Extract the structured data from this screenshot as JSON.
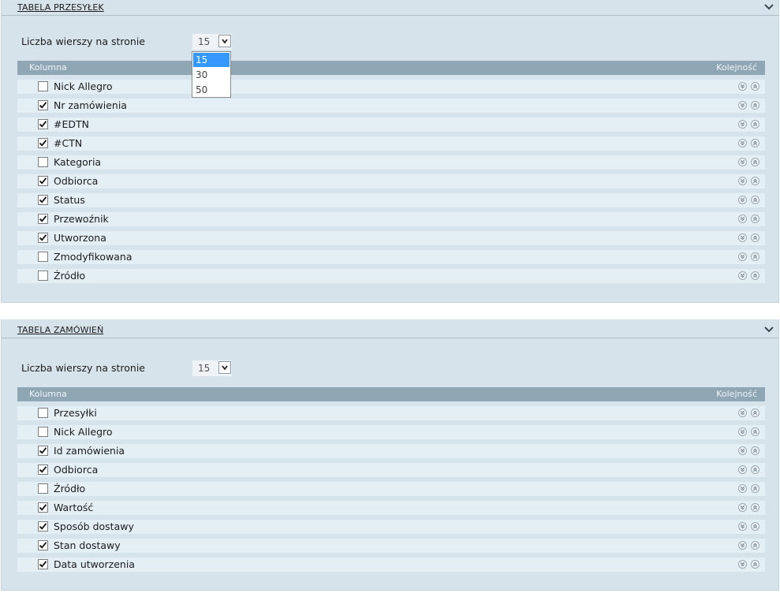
{
  "panels": [
    {
      "title": "TABELA PRZESYŁEK",
      "rows_label": "Liczba wierszy na stronie",
      "rows_per_page": "15",
      "header": {
        "column": "Kolumna",
        "order": "Kolejność"
      },
      "rows": [
        {
          "label": "Nick Allegro",
          "checked": false
        },
        {
          "label": "Nr zamówienia",
          "checked": true
        },
        {
          "label": "#EDTN",
          "checked": true
        },
        {
          "label": "#CTN",
          "checked": true
        },
        {
          "label": "Kategoria",
          "checked": false
        },
        {
          "label": "Odbiorca",
          "checked": true
        },
        {
          "label": "Status",
          "checked": true
        },
        {
          "label": "Przewoźnik",
          "checked": true
        },
        {
          "label": "Utworzona",
          "checked": true
        },
        {
          "label": "Zmodyfikowana",
          "checked": false
        },
        {
          "label": "Źródło",
          "checked": false
        }
      ]
    },
    {
      "title": "TABELA ZAMÓWIEŃ",
      "rows_label": "Liczba wierszy na stronie",
      "rows_per_page": "15",
      "header": {
        "column": "Kolumna",
        "order": "Kolejność"
      },
      "rows": [
        {
          "label": "Przesyłki",
          "checked": false
        },
        {
          "label": "Nick Allegro",
          "checked": false
        },
        {
          "label": "Id zamówienia",
          "checked": true
        },
        {
          "label": "Odbiorca",
          "checked": true
        },
        {
          "label": "Źródło",
          "checked": false
        },
        {
          "label": "Wartość",
          "checked": true
        },
        {
          "label": "Sposób dostawy",
          "checked": true
        },
        {
          "label": "Stan dostawy",
          "checked": true
        },
        {
          "label": "Data utworzenia",
          "checked": true
        }
      ]
    }
  ],
  "dropdown": {
    "options": [
      "15",
      "30",
      "50"
    ],
    "selected_index": 0
  },
  "icons": {
    "collapse": "chevron-down-icon",
    "move_down": "move-down-icon",
    "move_up": "move-up-icon",
    "checkmark": "checkmark-icon"
  },
  "colors": {
    "panel_bg": "#d7e3eb",
    "header_bar": "#8fa6b5",
    "row_bg": "#e3eef5",
    "selected_option": "#3399ff"
  }
}
